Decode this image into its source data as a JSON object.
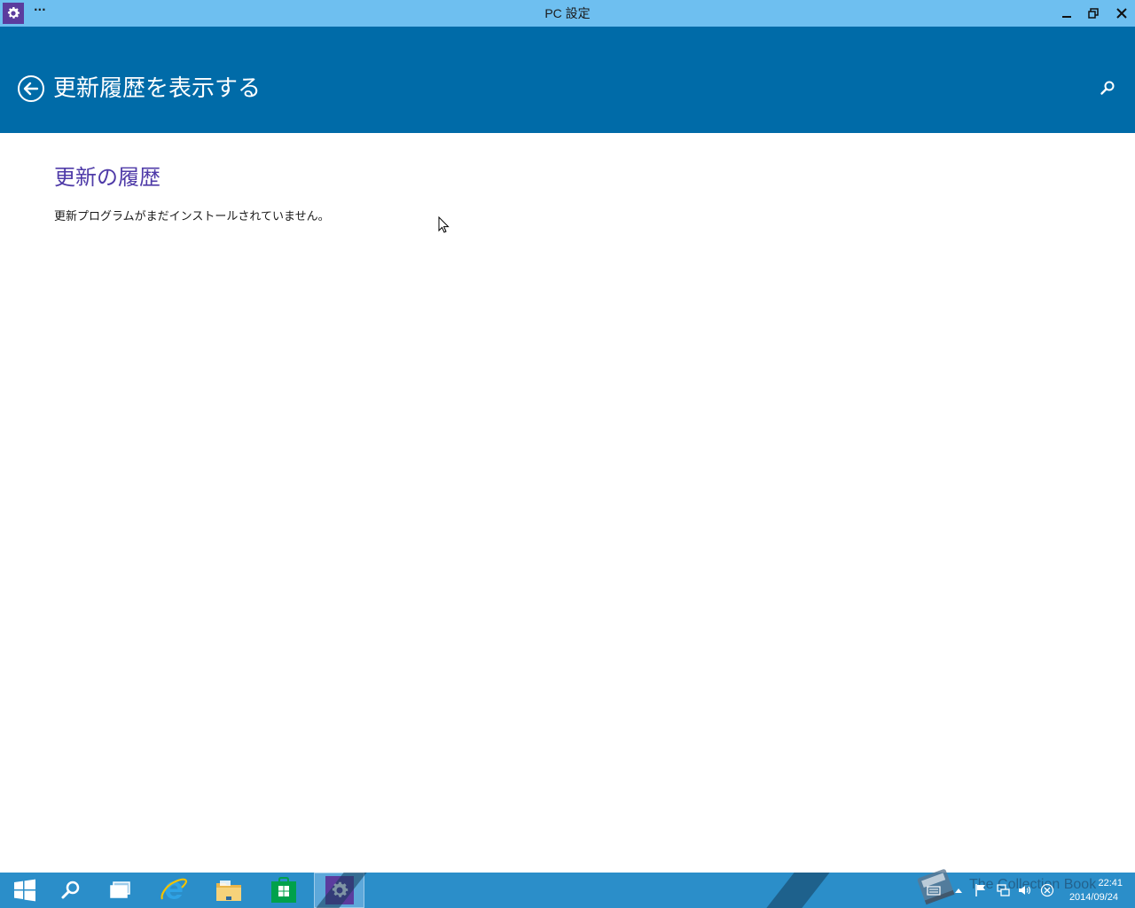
{
  "window": {
    "title": "PC 設定",
    "menu_label": "···"
  },
  "header": {
    "title": "更新履歴を表示する"
  },
  "content": {
    "section_title": "更新の履歴",
    "message": "更新プログラムがまだインストールされていません。"
  },
  "taskbar": {
    "items": [
      {
        "icon": "windows-start-icon"
      },
      {
        "icon": "search-icon"
      },
      {
        "icon": "task-view-icon"
      },
      {
        "icon": "internet-explorer-icon"
      },
      {
        "icon": "file-explorer-icon"
      },
      {
        "icon": "store-icon"
      },
      {
        "icon": "settings-gear-icon",
        "active": true
      }
    ],
    "watermark": "The Collection Book",
    "clock": {
      "time": "22:41",
      "date": "2014/09/24"
    }
  },
  "colors": {
    "titlebar": "#6ebff0",
    "header": "#006ba8",
    "accent": "#4f3ba8",
    "taskbar": "#2b8ec9",
    "app_icon": "#5b3c9e"
  }
}
